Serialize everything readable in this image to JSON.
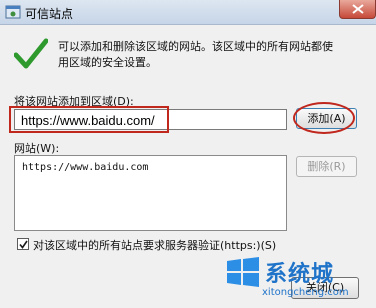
{
  "window": {
    "title": "可信站点"
  },
  "info": {
    "line1": "可以添加和删除该区域的网站。该区域中的所有网站都使",
    "line2": "用区域的安全设置。"
  },
  "add_section": {
    "label": "将该网站添加到区域(D):",
    "input_value": "https://www.baidu.com/",
    "add_button": "添加(A)"
  },
  "sites_section": {
    "label": "网站(W):",
    "sites": [
      "https://www.baidu.com"
    ],
    "remove_button": "删除(R)"
  },
  "https_check": {
    "label": "对该区域中的所有站点要求服务器验证(https:)(S)",
    "checked": true
  },
  "footer": {
    "close_button": "关闭(C)"
  },
  "watermark": {
    "brand": "系统城",
    "url": "xitongcheng.com"
  },
  "colors": {
    "accent_red": "#c0281e",
    "watermark_blue": "#1f73c9",
    "check_green": "#2e9a2e"
  }
}
